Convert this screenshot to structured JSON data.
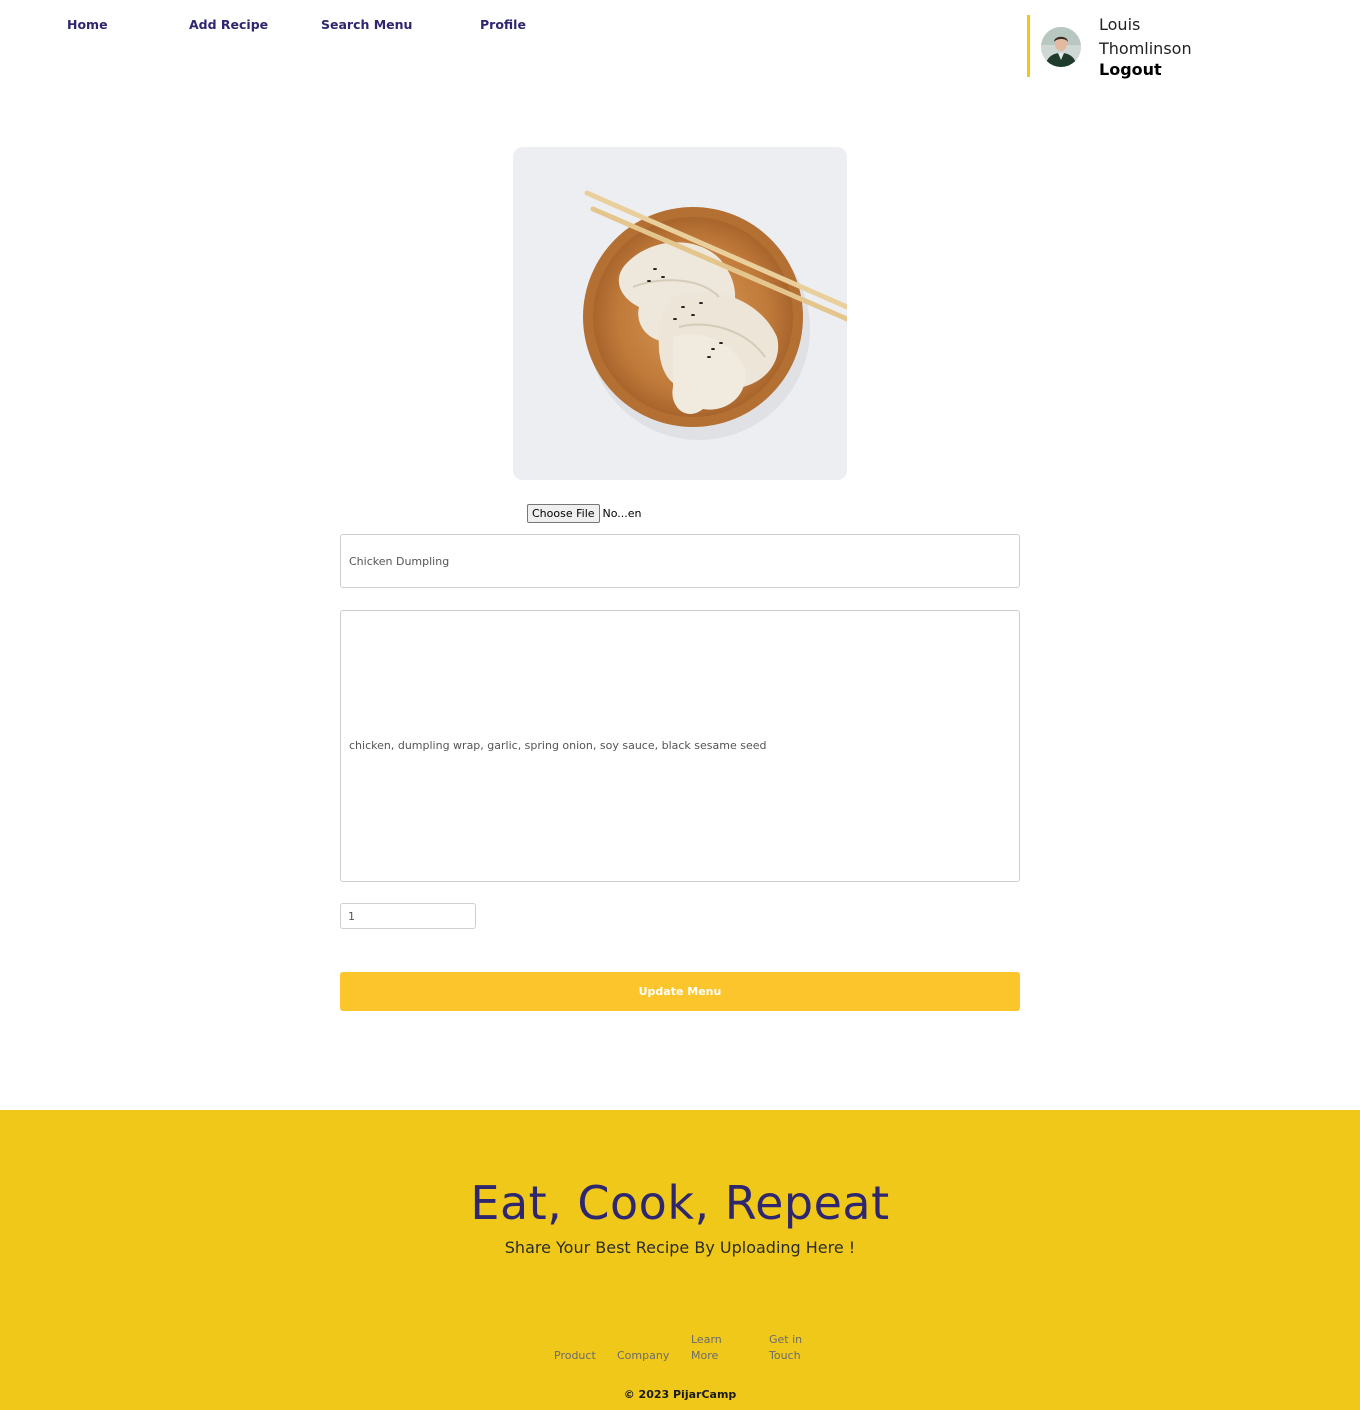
{
  "nav": {
    "links": [
      "Home",
      "Add Recipe",
      "Search Menu",
      "Profile"
    ]
  },
  "user": {
    "name": "Louis Thomlinson",
    "logout_label": "Logout"
  },
  "form": {
    "file_button_label": "Choose File",
    "file_name": "No...en",
    "title_value": "Chicken Dumpling",
    "ingredients_value": "chicken, dumpling wrap, garlic, spring onion, soy sauce, black sesame seed",
    "quantity_value": "1",
    "submit_label": "Update Menu"
  },
  "footer": {
    "headline": "Eat, Cook, Repeat",
    "subheadline": "Share Your Best Recipe By Uploading Here !",
    "links": [
      "Product",
      "Company",
      "Learn More",
      "Get in Touch"
    ],
    "copyright": "© 2023 PijarCamp"
  },
  "colors": {
    "accent_yellow": "#efc81a",
    "button_yellow": "#fcc52c",
    "brand_navy": "#2e266f"
  }
}
